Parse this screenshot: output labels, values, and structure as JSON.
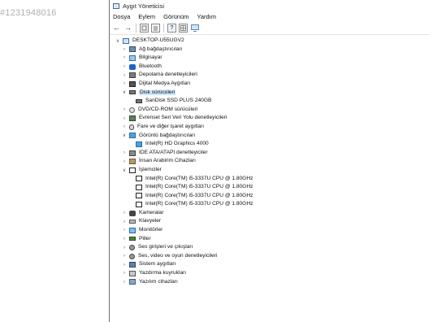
{
  "watermark": "#1231948016",
  "window": {
    "title": "Aygıt Yöneticisi",
    "menu": [
      "Dosya",
      "Eylem",
      "Görünüm",
      "Yardım"
    ]
  },
  "toolbar": {
    "buttons": [
      "back-arrow-icon",
      "forward-arrow-icon",
      "properties-icon",
      "list-icon",
      "help-icon",
      "grid-icon",
      "monitor-icon"
    ]
  },
  "tree": {
    "root": "DESKTOP-U55UGV2",
    "nodes": [
      {
        "label": "Ağ bağdaştırıcıları",
        "icon": "network-adapter-icon",
        "expander": ">"
      },
      {
        "label": "Bilgisayar",
        "icon": "computer-icon",
        "expander": ">"
      },
      {
        "label": "Bluetooth",
        "icon": "bluetooth-icon",
        "expander": ">"
      },
      {
        "label": "Depolama denetleyicileri",
        "icon": "storage-controller-icon",
        "expander": ">"
      },
      {
        "label": "Dijital Medya Aygıtları",
        "icon": "media-device-icon",
        "expander": ">"
      },
      {
        "label": "Disk sürücüleri",
        "icon": "disk-drive-icon",
        "expander": "v",
        "selected": true
      },
      {
        "label": "SanDisk SSD PLUS 240GB",
        "icon": "disk-icon",
        "expander": "",
        "child": true
      },
      {
        "label": "DVD/CD-ROM sürücüleri",
        "icon": "dvd-icon",
        "expander": ">"
      },
      {
        "label": "Evrensel Seri Veri Yolu denetleyicileri",
        "icon": "usb-icon",
        "expander": ">"
      },
      {
        "label": "Fare ve diğer işaret aygıtları",
        "icon": "mouse-icon",
        "expander": ">"
      },
      {
        "label": "Görüntü bağdaştırıcıları",
        "icon": "display-adapter-icon",
        "expander": "v"
      },
      {
        "label": "Intel(R) HD Graphics 4000",
        "icon": "display-icon",
        "expander": "",
        "child": true
      },
      {
        "label": "IDE ATA/ATAPI denetleyiciler",
        "icon": "ide-icon",
        "expander": ">"
      },
      {
        "label": "İnsan Arabirim Cihazları",
        "icon": "hid-icon",
        "expander": ">"
      },
      {
        "label": "İşlemciler",
        "icon": "processor-icon",
        "expander": "v"
      },
      {
        "label": "Intel(R) Core(TM) i5-3337U CPU @ 1.80GHz",
        "icon": "cpu-icon",
        "expander": "",
        "child": true
      },
      {
        "label": "Intel(R) Core(TM) i5-3337U CPU @ 1.80GHz",
        "icon": "cpu-icon",
        "expander": "",
        "child": true
      },
      {
        "label": "Intel(R) Core(TM) i5-3337U CPU @ 1.80GHz",
        "icon": "cpu-icon",
        "expander": "",
        "child": true
      },
      {
        "label": "Intel(R) Core(TM) i5-3337U CPU @ 1.80GHz",
        "icon": "cpu-icon",
        "expander": "",
        "child": true
      },
      {
        "label": "Kameralar",
        "icon": "camera-icon",
        "expander": ">"
      },
      {
        "label": "Klavyeler",
        "icon": "keyboard-icon",
        "expander": ">"
      },
      {
        "label": "Monitörler",
        "icon": "monitor-icon",
        "expander": ">"
      },
      {
        "label": "Piller",
        "icon": "battery-icon",
        "expander": ">"
      },
      {
        "label": "Ses girişleri ve çıkışları",
        "icon": "audio-io-icon",
        "expander": ">"
      },
      {
        "label": "Ses, video ve oyun denetleyicileri",
        "icon": "sound-controller-icon",
        "expander": ">"
      },
      {
        "label": "Sistem aygıtları",
        "icon": "system-device-icon",
        "expander": ">"
      },
      {
        "label": "Yazdırma kuyrukları",
        "icon": "print-queue-icon",
        "expander": ">"
      },
      {
        "label": "Yazılım cihazları",
        "icon": "software-device-icon",
        "expander": ">"
      }
    ]
  }
}
